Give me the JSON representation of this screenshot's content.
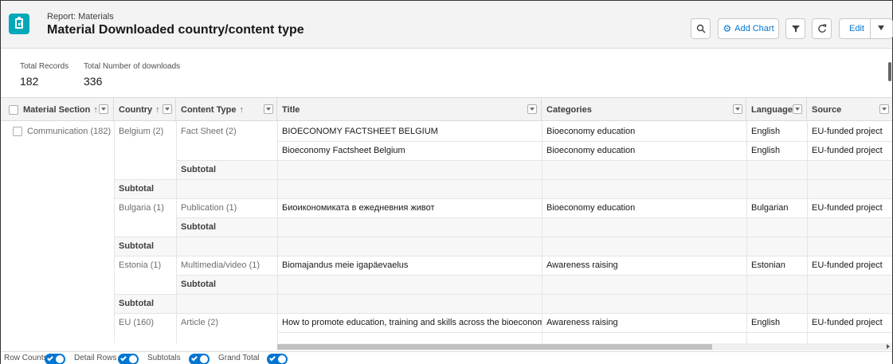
{
  "header": {
    "subtitle": "Report: Materials",
    "title": "Material Downloaded country/content type",
    "add_chart_label": "Add Chart",
    "edit_label": "Edit"
  },
  "summary": {
    "total_records_label": "Total Records",
    "total_records_value": "182",
    "total_downloads_label": "Total Number of downloads",
    "total_downloads_value": "336"
  },
  "columns": {
    "material_section": "Material Section",
    "country": "Country",
    "content_type": "Content Type",
    "title": "Title",
    "categories": "Categories",
    "language": "Language",
    "source": "Source",
    "sort_arrow": "↑"
  },
  "rows": {
    "r1": {
      "section": "Communication (182)",
      "country": "Belgium (2)",
      "content_type": "Fact Sheet (2)",
      "title": "BIOECONOMY FACTSHEET BELGIUM",
      "categories": "Bioeconomy education",
      "language": "English",
      "source": "EU-funded project"
    },
    "r2": {
      "title": "Bioeconomy Factsheet Belgium",
      "categories": "Bioeconomy education",
      "language": "English",
      "source": "EU-funded project"
    },
    "r5": {
      "country": "Bulgaria (1)",
      "content_type": "Publication (1)",
      "title": "Биоикономиката в ежедневния живот",
      "categories": "Bioeconomy education",
      "language": "Bulgarian",
      "source": "EU-funded project"
    },
    "r8": {
      "country": "Estonia (1)",
      "content_type": "Multimedia/video (1)",
      "title": "Biomajandus meie igapäevaelus",
      "categories": "Awareness raising",
      "language": "Estonian",
      "source": "EU-funded project"
    },
    "r11": {
      "country": "EU (160)",
      "content_type": "Article (2)",
      "title": "How to promote education, training and skills across the bioeconomy",
      "categories": "Awareness raising",
      "language": "English",
      "source": "EU-funded project"
    }
  },
  "subtotal_label": "Subtotal",
  "footer": {
    "row_counts": "Row Counts",
    "detail_rows": "Detail Rows",
    "subtotals": "Subtotals",
    "grand_total": "Grand Total",
    "row_counts_on": true,
    "detail_rows_on": true,
    "subtotals_on": true,
    "grand_total_on": true
  },
  "colors": {
    "accent": "#0176d3",
    "app_icon": "#03a9b8",
    "header_bg": "#f3f3f3"
  },
  "icons": {
    "app": "report-icon",
    "search": "search-icon",
    "add_chart": "chart-gear-icon",
    "filter": "filter-icon",
    "refresh": "refresh-icon",
    "edit_menu": "chevron-down-icon"
  }
}
